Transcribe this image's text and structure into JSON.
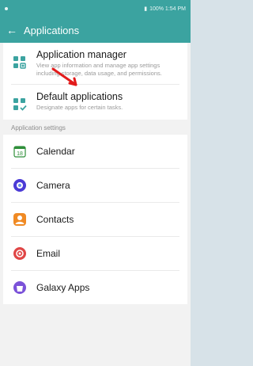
{
  "status": {
    "left": "",
    "right": "100% 1:54 PM"
  },
  "appbar": {
    "title": "Applications"
  },
  "top_card": {
    "items": [
      {
        "title": "Application manager",
        "desc": "View app information and manage app settings including storage, data usage, and permissions."
      },
      {
        "title": "Default applications",
        "desc": "Designate apps for certain tasks."
      }
    ]
  },
  "section": {
    "label": "Application settings"
  },
  "apps": [
    {
      "label": "Calendar",
      "icon": "calendar-icon",
      "color": "#2f8f3a"
    },
    {
      "label": "Camera",
      "icon": "camera-icon",
      "color": "#4b3bd6"
    },
    {
      "label": "Contacts",
      "icon": "contacts-icon",
      "color": "#f08a24"
    },
    {
      "label": "Email",
      "icon": "email-icon",
      "color": "#e04646"
    },
    {
      "label": "Galaxy Apps",
      "icon": "galaxy-apps-icon",
      "color": "#7b52d9"
    }
  ],
  "colors": {
    "accent": "#3ba3a0",
    "annotation": "#e21b1b"
  }
}
